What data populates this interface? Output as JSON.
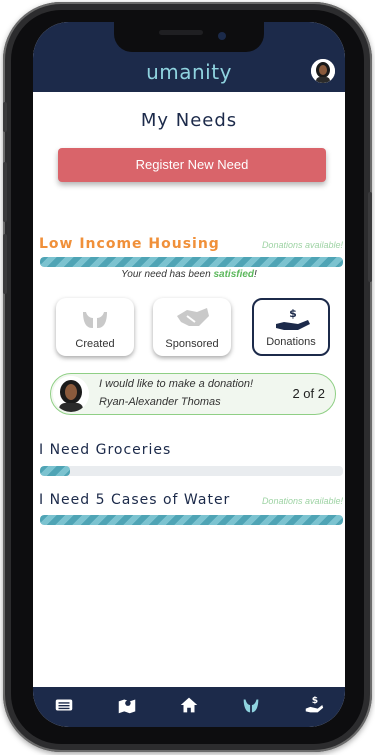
{
  "app": {
    "logo_text": "umanity",
    "user_avatar": "user-avatar-photo"
  },
  "page": {
    "title": "My Needs",
    "register_button": "Register New Need"
  },
  "needs": [
    {
      "title": "Low Income Housing",
      "donations_label": "Donations available!",
      "progress": 1.0,
      "status_prefix": "Your need has been ",
      "status_word": "satisfied",
      "status_suffix": "!",
      "steps": [
        {
          "label": "Created",
          "icon": "hands-icon",
          "active": false
        },
        {
          "label": "Sponsored",
          "icon": "handshake-icon",
          "active": false
        },
        {
          "label": "Donations",
          "icon": "donation-hand-icon",
          "active": true
        }
      ],
      "donor": {
        "message": "I would like to make a donation!",
        "name": "Ryan-Alexander Thomas",
        "counter": "2 of 2"
      }
    },
    {
      "title": "I Need Groceries",
      "progress": 0.1
    },
    {
      "title": "I Need 5 Cases of Water",
      "donations_label": "Donations available!",
      "progress": 1.0
    }
  ],
  "bottom_nav": [
    {
      "icon": "list-icon",
      "active": false
    },
    {
      "icon": "map-icon",
      "active": false
    },
    {
      "icon": "home-icon",
      "active": false
    },
    {
      "icon": "hands-icon",
      "active": true
    },
    {
      "icon": "donation-hand-icon",
      "active": false
    }
  ],
  "colors": {
    "navy": "#1c2a4a",
    "teal": "#4fa4b5",
    "accent_red": "#d9646a",
    "orange": "#f0903a",
    "green": "#5cb85c"
  }
}
